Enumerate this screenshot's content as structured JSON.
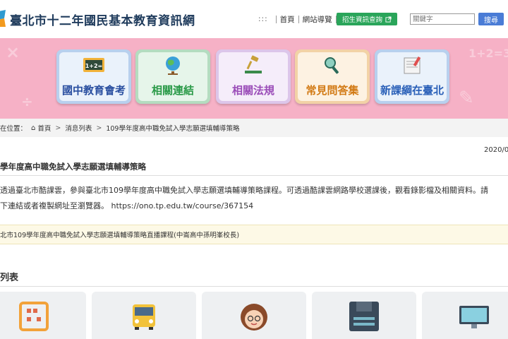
{
  "header": {
    "site_title": "臺北市十二年國民基本教育資訊網",
    "nav_dots": ":::",
    "nav_home": "首頁",
    "nav_sitemap": "網站導覽",
    "enroll_button": "招生資訊查詢",
    "search_placeholder": "關鍵字",
    "search_button": "搜尋"
  },
  "banner": {
    "cards": [
      {
        "label": "國中教育會考",
        "icon": "chalkboard-icon",
        "color": "#2a4fa0"
      },
      {
        "label": "相關連結",
        "icon": "globe-icon",
        "color": "#2a9a48"
      },
      {
        "label": "相關法規",
        "icon": "gavel-icon",
        "color": "#9a4cb8"
      },
      {
        "label": "常見問答集",
        "icon": "magnifier-icon",
        "color": "#d27a14"
      },
      {
        "label": "新課綱在臺北",
        "icon": "book-icon",
        "color": "#2a60b8"
      }
    ]
  },
  "breadcrumb": {
    "prefix": "在位置：",
    "home": "首頁",
    "news": "消息列表",
    "current": "109學年度高中職免試入學志願選填輔導策略"
  },
  "article": {
    "date": "2020/0",
    "title": "學年度高中職免試入學志願選填輔導策略",
    "line1": "透過臺北市酷課雲，參與臺北市109學年度高中職免試入學志願選填輔導策略課程。可透過酷課雲網路學校選課後，觀看錄影檔及相關資料。請",
    "line2": "下連結或者複製網址至瀏覽器。 https://ono.tp.edu.tw/course/367154",
    "attachment": "北市109學年度高中職免試入學志願選填輔導策略直播課程(中崙高中孫明峯校長)"
  },
  "list": {
    "title": "列表"
  },
  "colors": {
    "banner_bg": "#f6b1c6",
    "enroll_green": "#2aa55a",
    "search_blue": "#4a7cd6"
  }
}
